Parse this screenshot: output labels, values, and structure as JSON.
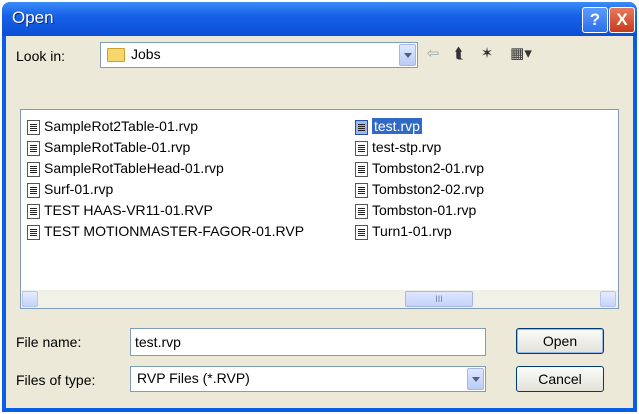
{
  "window": {
    "title": "Open"
  },
  "title_buttons": {
    "help": "?",
    "close": "X"
  },
  "look_in": {
    "label": "Look in:",
    "value": "Jobs"
  },
  "files": [
    {
      "name": "SampleRot2Table-01.rvp",
      "selected": false
    },
    {
      "name": "SampleRotTable-01.rvp",
      "selected": false
    },
    {
      "name": "SampleRotTableHead-01.rvp",
      "selected": false
    },
    {
      "name": "Surf-01.rvp",
      "selected": false
    },
    {
      "name": "TEST HAAS-VR11-01.RVP",
      "selected": false
    },
    {
      "name": "TEST MOTIONMASTER-FAGOR-01.RVP",
      "selected": false
    },
    {
      "name": "test.rvp",
      "selected": true
    },
    {
      "name": "test-stp.rvp",
      "selected": false
    },
    {
      "name": "Tombston2-01.rvp",
      "selected": false
    },
    {
      "name": "Tombston2-02.rvp",
      "selected": false
    },
    {
      "name": "Tombston-01.rvp",
      "selected": false
    },
    {
      "name": "Turn1-01.rvp",
      "selected": false
    }
  ],
  "file_name": {
    "label": "File name:",
    "value": "test.rvp"
  },
  "file_type": {
    "label": "Files of type:",
    "value": "RVP Files (*.RVP)"
  },
  "buttons": {
    "open": "Open",
    "cancel": "Cancel"
  },
  "scrollbar": {
    "thumb_grip": "III"
  }
}
